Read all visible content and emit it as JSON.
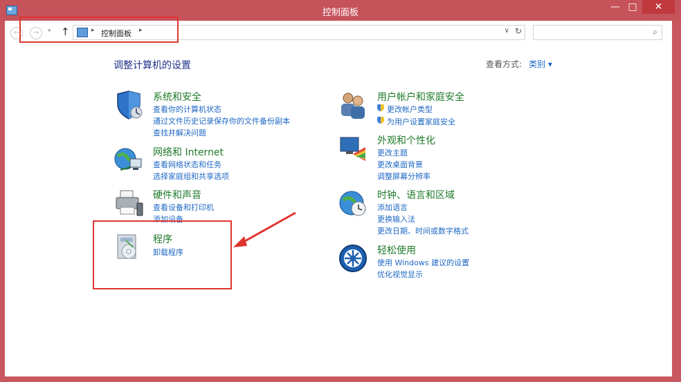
{
  "window": {
    "title": "控制面板",
    "min": "—",
    "max": "□",
    "close": "✕"
  },
  "nav": {
    "back": "←",
    "forward": "→",
    "dropdown": "▾",
    "up": "↑",
    "breadcrumb": "控制面板",
    "sep": "▸",
    "addr_drop": "∨",
    "refresh": "↻",
    "search_placeholder": "",
    "search_icon": "⌕"
  },
  "heading": "调整计算机的设置",
  "view_by": {
    "label": "查看方式:",
    "value": "类别 ▾"
  },
  "left_categories": [
    {
      "title": "系统和安全",
      "links": [
        "查看你的计算机状态",
        "通过文件历史记录保存你的文件备份副本",
        "查找并解决问题"
      ]
    },
    {
      "title": "网络和 Internet",
      "links": [
        "查看网络状态和任务",
        "选择家庭组和共享选项"
      ]
    },
    {
      "title": "硬件和声音",
      "links": [
        "查看设备和打印机",
        "添加设备"
      ]
    },
    {
      "title": "程序",
      "links": [
        "卸载程序"
      ]
    }
  ],
  "right_categories": [
    {
      "title": "用户帐户和家庭安全",
      "links": [
        "更改帐户类型",
        "为用户设置家庭安全"
      ]
    },
    {
      "title": "外观和个性化",
      "links": [
        "更改主题",
        "更改桌面背景",
        "调整屏幕分辨率"
      ]
    },
    {
      "title": "时钟、语言和区域",
      "links": [
        "添加语言",
        "更换输入法",
        "更改日期、时间或数字格式"
      ]
    },
    {
      "title": "轻松使用",
      "links": [
        "使用 Windows 建议的设置",
        "优化视觉显示"
      ]
    }
  ],
  "colors": {
    "accent": "#1e68c4",
    "category_title": "#1e7a2a",
    "highlight": "#e0342f",
    "titlebar": "#c6525a"
  }
}
